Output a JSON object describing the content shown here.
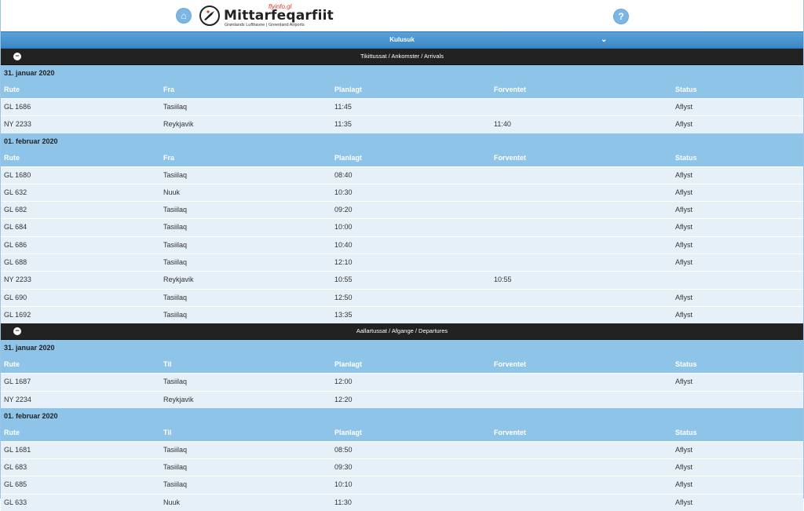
{
  "header": {
    "logo_flyinfo": "flyinfo.gl",
    "logo_title": "Mittarfeqarfiit",
    "logo_subtitle": "Grønlands Lufthavne | Greenland Airports",
    "home_glyph": "⌂",
    "help_glyph": "?"
  },
  "location": {
    "label": "Kulusuk",
    "chevron": "⌄"
  },
  "arrivals": {
    "title": "Tikittussat / Ankomster / Arrivals",
    "toggle": "−",
    "columns": [
      "Rute",
      "Fra",
      "Planlagt",
      "Forventet",
      "Status"
    ],
    "days": [
      {
        "date": "31. januar 2020",
        "flights": [
          {
            "route": "GL 1686",
            "place": "Tasiilaq",
            "planned": "11:45",
            "expected": "",
            "status": "Aflyst"
          },
          {
            "route": "NY 2233",
            "place": "Reykjavik",
            "planned": "11:35",
            "expected": "11:40",
            "status": "Aflyst"
          }
        ]
      },
      {
        "date": "01. februar 2020",
        "flights": [
          {
            "route": "GL 1680",
            "place": "Tasiilaq",
            "planned": "08:40",
            "expected": "",
            "status": "Aflyst"
          },
          {
            "route": "GL 632",
            "place": "Nuuk",
            "planned": "10:30",
            "expected": "",
            "status": "Aflyst"
          },
          {
            "route": "GL 682",
            "place": "Tasiilaq",
            "planned": "09:20",
            "expected": "",
            "status": "Aflyst"
          },
          {
            "route": "GL 684",
            "place": "Tasiilaq",
            "planned": "10:00",
            "expected": "",
            "status": "Aflyst"
          },
          {
            "route": "GL 686",
            "place": "Tasiilaq",
            "planned": "10:40",
            "expected": "",
            "status": "Aflyst"
          },
          {
            "route": "GL 688",
            "place": "Tasiilaq",
            "planned": "12:10",
            "expected": "",
            "status": "Aflyst"
          },
          {
            "route": "NY 2233",
            "place": "Reykjavik",
            "planned": "10:55",
            "expected": "10:55",
            "status": ""
          },
          {
            "route": "GL 690",
            "place": "Tasiilaq",
            "planned": "12:50",
            "expected": "",
            "status": "Aflyst"
          },
          {
            "route": "GL 1692",
            "place": "Tasiilaq",
            "planned": "13:35",
            "expected": "",
            "status": "Aflyst"
          }
        ]
      }
    ]
  },
  "departures": {
    "title": "Aallartussat / Afgange / Departures",
    "toggle": "−",
    "columns": [
      "Rute",
      "Til",
      "Planlagt",
      "Forventet",
      "Status"
    ],
    "days": [
      {
        "date": "31. januar 2020",
        "flights": [
          {
            "route": "GL 1687",
            "place": "Tasiilaq",
            "planned": "12:00",
            "expected": "",
            "status": "Aflyst"
          },
          {
            "route": "NY 2234",
            "place": "Reykjavik",
            "planned": "12:20",
            "expected": "",
            "status": ""
          }
        ]
      },
      {
        "date": "01. februar 2020",
        "flights": [
          {
            "route": "GL 1681",
            "place": "Tasiilaq",
            "planned": "08:50",
            "expected": "",
            "status": "Aflyst"
          },
          {
            "route": "GL 683",
            "place": "Tasiilaq",
            "planned": "09:30",
            "expected": "",
            "status": "Aflyst"
          },
          {
            "route": "GL 685",
            "place": "Tasiilaq",
            "planned": "10:10",
            "expected": "",
            "status": "Aflyst"
          },
          {
            "route": "GL 633",
            "place": "Nuuk",
            "planned": "11:30",
            "expected": "",
            "status": "Aflyst"
          }
        ]
      }
    ]
  }
}
